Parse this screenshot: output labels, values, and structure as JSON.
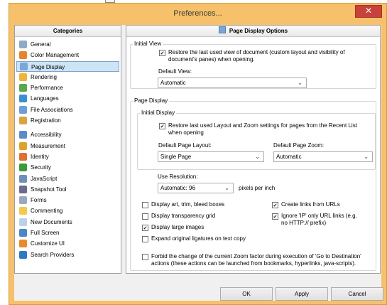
{
  "window": {
    "title": "Preferences...",
    "close_glyph": "✕"
  },
  "categories": {
    "header": "Categories",
    "items": [
      {
        "label": "General",
        "icon": "gear-icon",
        "color": "#8fa9c9",
        "selected": false,
        "gap": false
      },
      {
        "label": "Color Management",
        "icon": "color-wheel-icon",
        "color": "#e8842a",
        "selected": false,
        "gap": false
      },
      {
        "label": "Page Display",
        "icon": "page-display-icon",
        "color": "#7aa6d8",
        "selected": true,
        "gap": false
      },
      {
        "label": "Rendering",
        "icon": "rendering-icon",
        "color": "#f0b43a",
        "selected": false,
        "gap": false
      },
      {
        "label": "Performance",
        "icon": "performance-icon",
        "color": "#5aa84a",
        "selected": false,
        "gap": false
      },
      {
        "label": "Languages",
        "icon": "globe-icon",
        "color": "#3a8fd0",
        "selected": false,
        "gap": false
      },
      {
        "label": "File Associations",
        "icon": "file-associations-icon",
        "color": "#6d9ed6",
        "selected": false,
        "gap": false
      },
      {
        "label": "Registration",
        "icon": "registration-icon",
        "color": "#d9a441",
        "selected": false,
        "gap": false
      },
      {
        "label": "Accessibility",
        "icon": "accessibility-icon",
        "color": "#5b8bc9",
        "selected": false,
        "gap": true
      },
      {
        "label": "Measurement",
        "icon": "measurement-icon",
        "color": "#e0a030",
        "selected": false,
        "gap": false
      },
      {
        "label": "Identity",
        "icon": "identity-icon",
        "color": "#e07030",
        "selected": false,
        "gap": false
      },
      {
        "label": "Security",
        "icon": "shield-icon",
        "color": "#3b9a3b",
        "selected": false,
        "gap": false
      },
      {
        "label": "JavaScript",
        "icon": "javascript-icon",
        "color": "#6f8fb8",
        "selected": false,
        "gap": false
      },
      {
        "label": "Snapshot Tool",
        "icon": "camera-icon",
        "color": "#6b6b8b",
        "selected": false,
        "gap": false
      },
      {
        "label": "Forms",
        "icon": "forms-icon",
        "color": "#9aa9bd",
        "selected": false,
        "gap": false
      },
      {
        "label": "Commenting",
        "icon": "comment-icon",
        "color": "#f2c94c",
        "selected": false,
        "gap": false
      },
      {
        "label": "New Documents",
        "icon": "new-document-icon",
        "color": "#bcd0ea",
        "selected": false,
        "gap": false
      },
      {
        "label": "Full Screen",
        "icon": "full-screen-icon",
        "color": "#4a86c8",
        "selected": false,
        "gap": false
      },
      {
        "label": "Customize UI",
        "icon": "customize-ui-icon",
        "color": "#e88a2c",
        "selected": false,
        "gap": false
      },
      {
        "label": "Search Providers",
        "icon": "search-providers-icon",
        "color": "#2f78c4",
        "selected": false,
        "gap": false
      }
    ]
  },
  "options": {
    "header": "Page Display Options",
    "initial_view": {
      "legend": "Initial View",
      "restore_label": "Restore the last used view of document (custom layout and visibility of document's panes) when opening.",
      "restore_checked": true,
      "default_view_label": "Default View:",
      "default_view_value": "Automatic"
    },
    "page_display": {
      "legend": "Page Display",
      "initial_display": {
        "legend": "Initial Display",
        "restore_label": "Restore last used Layout and Zoom settings for pages from the Recent List when opening",
        "restore_checked": true,
        "layout_label": "Default Page Layout:",
        "layout_value": "Single Page",
        "zoom_label": "Default Page Zoom:",
        "zoom_value": "Automatic"
      },
      "resolution_label": "Use Resolution:",
      "resolution_value": "Automatic: 96",
      "resolution_unit": "pixels per inch",
      "display_art_label": "Display art, trim, bleed boxes",
      "display_art_checked": false,
      "transparency_grid_label": "Display transparency grid",
      "transparency_grid_checked": false,
      "large_images_label": "Display large images",
      "large_images_checked": true,
      "ligatures_label": "Expand original ligatures on text copy",
      "ligatures_checked": false,
      "create_links_label": "Create links from URLs",
      "create_links_checked": true,
      "ignore_ip_label": "Ignore 'IP' only URL links (e.g. no HTTP:// prefix)",
      "ignore_ip_checked": true,
      "forbid_zoom_label": "Forbid the change of the current Zoom factor during execution of 'Go to Destination' actions (these actions can be launched from bookmarks, hyperlinks, java-scripts).",
      "forbid_zoom_checked": false
    }
  },
  "buttons": {
    "ok": "OK",
    "apply": "Apply",
    "cancel": "Cancel"
  }
}
